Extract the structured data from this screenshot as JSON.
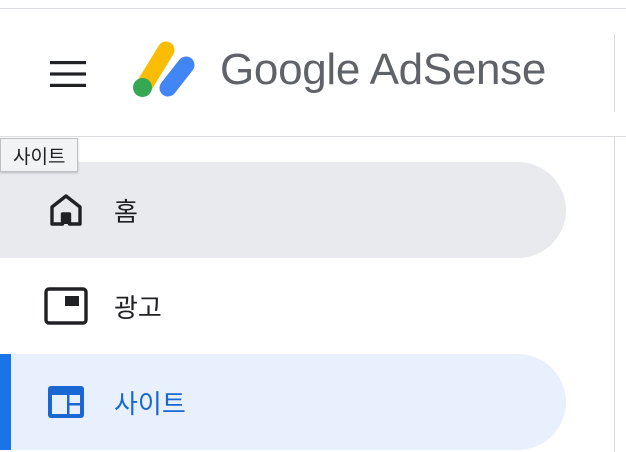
{
  "header": {
    "brand_text": "Google AdSense",
    "menu_icon": "hamburger-menu-icon",
    "logo_icon": "adsense-logo-icon"
  },
  "tooltip": {
    "text": "사이트"
  },
  "sidebar": {
    "items": [
      {
        "label": "홈",
        "icon": "home-icon",
        "state": "hover"
      },
      {
        "label": "광고",
        "icon": "ad-units-icon",
        "state": "default"
      },
      {
        "label": "사이트",
        "icon": "sites-icon",
        "state": "active"
      }
    ]
  },
  "colors": {
    "accent": "#1a73e8",
    "active_background": "#e8f0fe",
    "hover_background": "#e8eaed",
    "logo_yellow": "#fbbc04",
    "logo_blue": "#4285f4",
    "logo_green": "#34a853"
  }
}
